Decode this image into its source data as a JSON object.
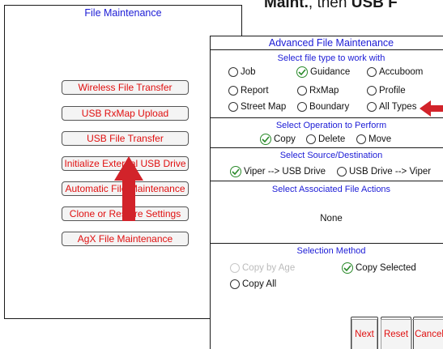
{
  "caption": {
    "pre": "Maint.",
    "mid": ", then ",
    "bold2": "USB F"
  },
  "file_maintenance": {
    "title": "File Maintenance",
    "buttons": [
      "Wireless File Transfer",
      "USB RxMap Upload",
      "USB File Transfer",
      "Initialize External USB Drive",
      "Automatic File Maintenance",
      "Clone or Restore Settings",
      "AgX File Maintenance"
    ]
  },
  "advanced": {
    "title": "Advanced File Maintenance",
    "file_type_header": "Select file type to work with",
    "file_types": {
      "job": "Job",
      "guidance": "Guidance",
      "accuboom": "Accuboom",
      "report": "Report",
      "rxmap": "RxMap",
      "profile": "Profile",
      "street_map": "Street Map",
      "boundary": "Boundary",
      "all_types": "All Types"
    },
    "selected_file_type": "Guidance",
    "operation_header": "Select Operation to Perform",
    "operations": {
      "copy": "Copy",
      "delete": "Delete",
      "move": "Move"
    },
    "selected_operation": "Copy",
    "source_header": "Select Source/Destination",
    "sources": {
      "viper_to_usb": "Viper --> USB Drive",
      "usb_to_viper": "USB Drive --> Viper"
    },
    "selected_source": "Viper --> USB Drive",
    "actions_header": "Select Associated File Actions",
    "actions_value": "None",
    "selection_header": "Selection Method",
    "selection": {
      "copy_by_age": "Copy by Age",
      "copy_selected": "Copy Selected",
      "copy_all": "Copy All"
    },
    "selected_method": "Copy Selected",
    "buttons": {
      "next": "Next",
      "reset": "Reset",
      "cancel": "Cancel"
    }
  },
  "colors": {
    "title_blue": "#1c1cd6",
    "button_red": "#e01010",
    "arrow_red": "#d2232a",
    "check_green": "#2a8a2a"
  }
}
